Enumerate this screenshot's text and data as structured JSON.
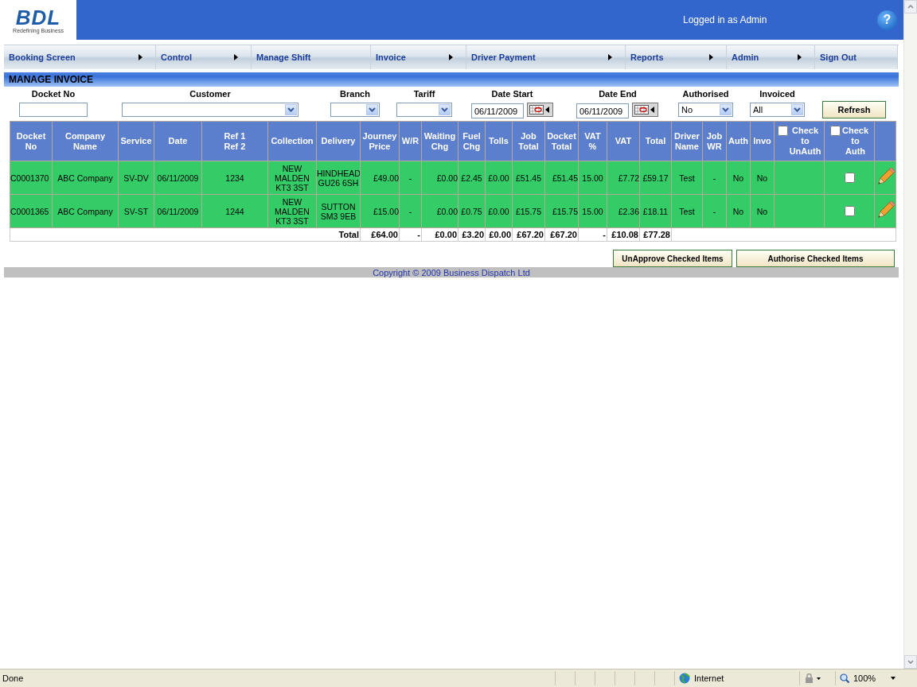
{
  "header": {
    "logo": "BDL",
    "tagline": "Redefining Business",
    "login_text": "Logged in as Admin",
    "help": "?"
  },
  "nav": [
    {
      "label": "Booking Screen",
      "has_submenu": true
    },
    {
      "label": "Control",
      "has_submenu": true
    },
    {
      "label": "Manage Shift",
      "has_submenu": false
    },
    {
      "label": "Invoice",
      "has_submenu": true
    },
    {
      "label": "Driver Payment",
      "has_submenu": true
    },
    {
      "label": "Reports",
      "has_submenu": true
    },
    {
      "label": "Admin",
      "has_submenu": true
    },
    {
      "label": "Sign Out",
      "has_submenu": false
    }
  ],
  "section_title": "MANAGE INVOICE",
  "filters": [
    {
      "label": "Docket No",
      "kind": "text"
    },
    {
      "label": "Customer",
      "kind": "select"
    },
    {
      "label": "Branch",
      "kind": "select"
    },
    {
      "label": "Tariff",
      "kind": "select"
    },
    {
      "label": "Date Start",
      "kind": "date",
      "value": "06/11/2009"
    },
    {
      "label": "Date End",
      "kind": "date",
      "value": "06/11/2009"
    },
    {
      "label": "Authorised",
      "kind": "select",
      "value": "No"
    },
    {
      "label": "Invoiced",
      "kind": "select",
      "value": "All"
    }
  ],
  "refresh_button": "Refresh",
  "table": {
    "columns": [
      {
        "label": "Docket\nNo",
        "kind": "text"
      },
      {
        "label": "Company\nName",
        "kind": "text"
      },
      {
        "label": "Service",
        "kind": "text"
      },
      {
        "label": "Date",
        "kind": "text"
      },
      {
        "label": "Ref 1\nRef 2",
        "kind": "text"
      },
      {
        "label": "Collection",
        "kind": "text"
      },
      {
        "label": "Delivery",
        "kind": "text"
      },
      {
        "label": "Journey\nPrice",
        "kind": "text"
      },
      {
        "label": "W/R",
        "kind": "text"
      },
      {
        "label": "Waiting\nChg",
        "kind": "text"
      },
      {
        "label": "Fuel\nChg",
        "kind": "text"
      },
      {
        "label": "Tolls",
        "kind": "text"
      },
      {
        "label": "Job\nTotal",
        "kind": "text"
      },
      {
        "label": "Docket\nTotal",
        "kind": "text"
      },
      {
        "label": "VAT\n%",
        "kind": "text"
      },
      {
        "label": "VAT",
        "kind": "text"
      },
      {
        "label": "Total",
        "kind": "text"
      },
      {
        "label": "Driver\nName",
        "kind": "text"
      },
      {
        "label": "Job\nWR",
        "kind": "text"
      },
      {
        "label": "Auth",
        "kind": "text"
      },
      {
        "label": "Invo",
        "kind": "text"
      },
      {
        "label": "Check\nto\nUnAuth",
        "kind": "checkbox",
        "checked": false
      },
      {
        "label": "Check\nto\nAuth",
        "kind": "checkbox",
        "checked": false
      }
    ],
    "rows": [
      {
        "cells": [
          "C0001370",
          "ABC Company",
          "SV-DV",
          "06/11/2009",
          "1234",
          "NEW\nMALDEN\nKT3 3ST",
          "HINDHEAD\nGU26 6SH",
          "£49.00",
          "-",
          "£0.00",
          "£2.45",
          "£0.00",
          "£51.45",
          "£51.45",
          "15.00",
          "£7.72",
          "£59.17",
          "Test",
          "-",
          "No",
          "No"
        ],
        "auth_checked": false
      },
      {
        "cells": [
          "C0001365",
          "ABC Company",
          "SV-ST",
          "06/11/2009",
          "1244",
          "NEW\nMALDEN\nKT3 3ST",
          "SUTTON\nSM3 9EB",
          "£15.00",
          "-",
          "£0.00",
          "£0.75",
          "£0.00",
          "£15.75",
          "£15.75",
          "15.00",
          "£2.36",
          "£18.11",
          "Test",
          "-",
          "No",
          "No"
        ],
        "auth_checked": false
      }
    ],
    "totals": {
      "label": "Total",
      "values": [
        "£64.00",
        "-",
        "£0.00",
        "£3.20",
        "£0.00",
        "£67.20",
        "£67.20",
        "-",
        "£10.08",
        "£77.28"
      ]
    }
  },
  "actions": [
    "UnApprove Checked Items",
    "Authorise Checked Items"
  ],
  "copyright": "Copyright © 2009 Business Dispatch Ltd",
  "status_bar": {
    "status": "Done",
    "zone": "Internet",
    "zoom": "100%"
  }
}
